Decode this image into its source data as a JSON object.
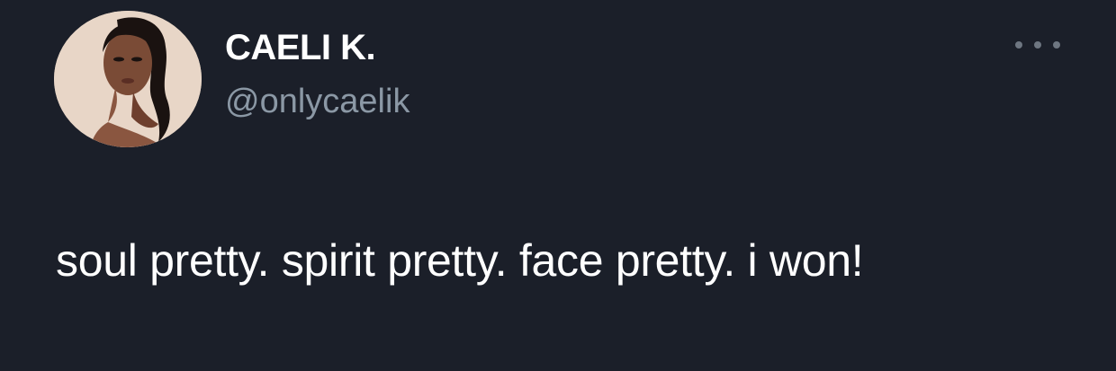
{
  "tweet": {
    "author": {
      "display_name": "CAELI K.",
      "handle": "@onlycaelik",
      "avatar_icon": "profile-photo"
    },
    "more_icon": "more-horizontal-icon",
    "text": "soul pretty. spirit pretty. face pretty. i won!"
  },
  "colors": {
    "background": "#1b1f29",
    "name": "#ffffff",
    "handle": "#8b98a5",
    "text": "#ffffff",
    "more_dots": "#6e7681"
  }
}
